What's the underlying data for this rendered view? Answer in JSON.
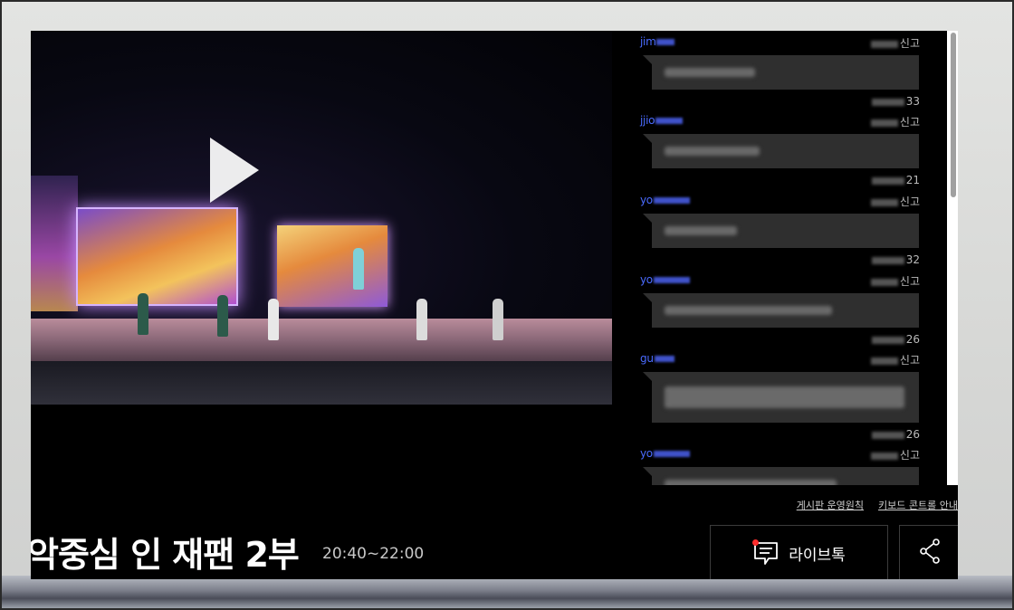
{
  "program": {
    "title": "악중심 인 재팬 2부",
    "time_range": "20:40~22:00"
  },
  "chat": {
    "messages": [
      {
        "user": "jim",
        "report": "신고",
        "time": "33"
      },
      {
        "user": "jjio",
        "report": "신고",
        "time": "21"
      },
      {
        "user": "yo",
        "report": "신고",
        "time": "32"
      },
      {
        "user": "yo",
        "report": "신고",
        "time": "26"
      },
      {
        "user": "gu",
        "report": "신고",
        "time": "26"
      },
      {
        "user": "yo",
        "report": "신고",
        "time": ""
      }
    ]
  },
  "footer_links": {
    "board_rules": "게시판 운영원칙",
    "keyboard_guide": "키보드 콘트롤 안내"
  },
  "buttons": {
    "livetalk_label": "라이브톡"
  },
  "icons": {
    "play": "play-icon",
    "livetalk": "chat-bubble-icon",
    "share": "share-icon"
  },
  "colors": {
    "username": "#4a6bff",
    "notification_dot": "#ff2d2d",
    "bubble": "#2f2f2f"
  }
}
